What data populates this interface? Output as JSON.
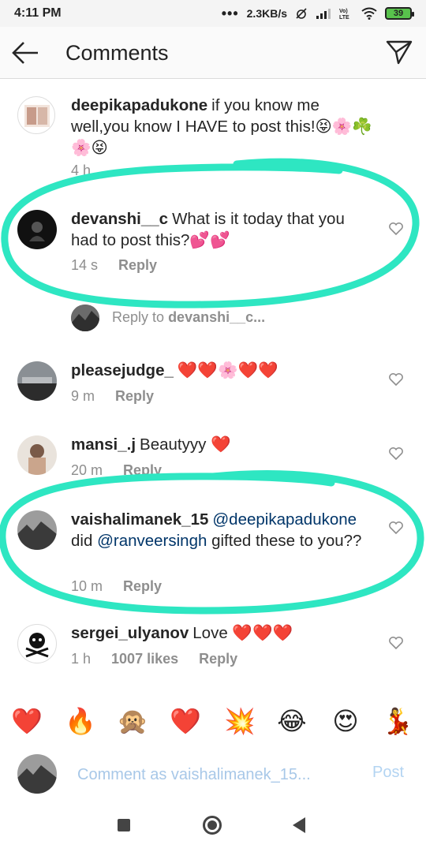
{
  "status_bar": {
    "time": "4:11 PM",
    "dots": "•••",
    "speed": "2.3KB/s",
    "battery": "39"
  },
  "header": {
    "title": "Comments"
  },
  "comments": [
    {
      "username": "deepikapadukone",
      "text": "if you know me well,you know I HAVE to post this!😝🌸☘️🌸😝",
      "time": "4 h"
    },
    {
      "username": "devanshi__c",
      "text": "What is it today that you had to post this?💕💕",
      "time": "14 s",
      "reply": "Reply"
    },
    {
      "username": "pleasejudge_",
      "text": "❤️❤️🌸❤️❤️",
      "time": "9 m",
      "reply": "Reply"
    },
    {
      "username": "mansi_.j",
      "text": "Beautyyy ❤️",
      "time": "20 m",
      "reply": "Reply"
    },
    {
      "username": "vaishalimanek_15",
      "mention1": "@deepikapadukone",
      "text_mid": "did",
      "mention2": "@ranveersingh",
      "text_end": "gifted these to you??",
      "time": "10 m",
      "reply": "Reply"
    },
    {
      "username": "sergei_ulyanov",
      "text": "Love ❤️❤️❤️",
      "time": "1 h",
      "likes": "1007 likes",
      "reply": "Reply"
    }
  ],
  "reply_to": {
    "prefix": "Reply to",
    "user": "devanshi__c..."
  },
  "emoji_bar": [
    "❤️",
    "🔥",
    "🙊",
    "❤️",
    "💥",
    "😂",
    "😍",
    "💃"
  ],
  "input": {
    "placeholder": "Comment as vaishalimanek_15...",
    "post_label": "Post"
  },
  "colors": {
    "highlight": "#2ee6c2",
    "link": "#003569",
    "muted": "#8e8e8e"
  }
}
